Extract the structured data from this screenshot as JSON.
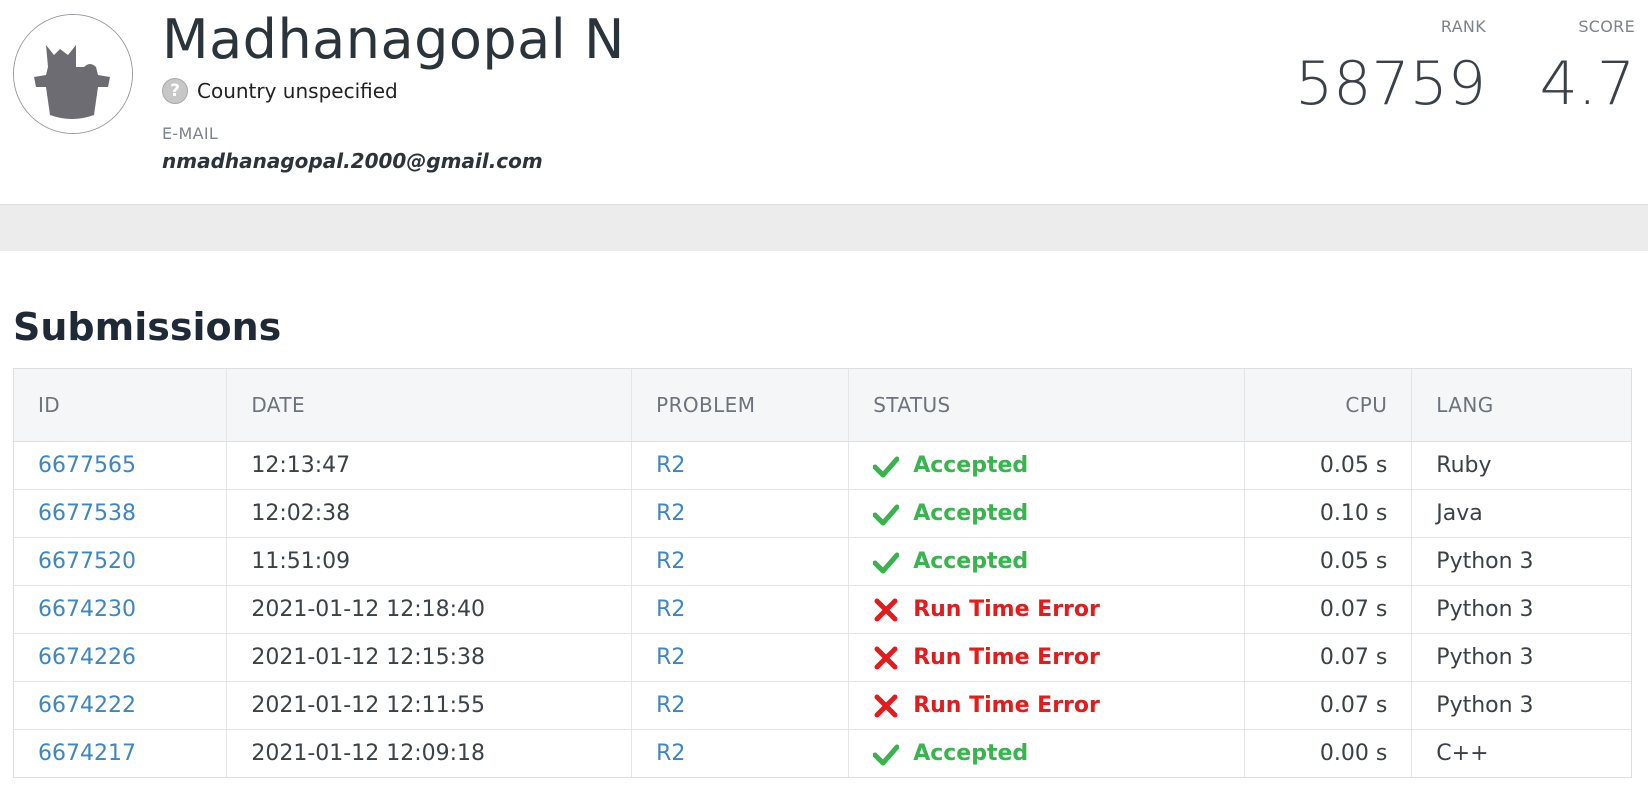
{
  "profile": {
    "name": "Madhanagopal N",
    "country": "Country unspecified",
    "email_label": "E-MAIL",
    "email": "nmadhanagopal.2000@gmail.com",
    "avatar": "cat-avatar-icon",
    "country_icon": "question-mark-icon"
  },
  "stats": {
    "rank_label": "RANK",
    "rank_value": "58759",
    "score_label": "SCORE",
    "score_value": "4.7"
  },
  "submissions": {
    "title": "Submissions",
    "columns": {
      "id": "ID",
      "date": "DATE",
      "problem": "PROBLEM",
      "status": "STATUS",
      "cpu": "CPU",
      "lang": "LANG"
    },
    "rows": [
      {
        "id": "6677565",
        "date": "12:13:47",
        "problem": "R2",
        "status": "Accepted",
        "status_kind": "ok",
        "cpu": "0.05 s",
        "lang": "Ruby"
      },
      {
        "id": "6677538",
        "date": "12:02:38",
        "problem": "R2",
        "status": "Accepted",
        "status_kind": "ok",
        "cpu": "0.10 s",
        "lang": "Java"
      },
      {
        "id": "6677520",
        "date": "11:51:09",
        "problem": "R2",
        "status": "Accepted",
        "status_kind": "ok",
        "cpu": "0.05 s",
        "lang": "Python 3"
      },
      {
        "id": "6674230",
        "date": "2021-01-12 12:18:40",
        "problem": "R2",
        "status": "Run Time Error",
        "status_kind": "err",
        "cpu": "0.07 s",
        "lang": "Python 3"
      },
      {
        "id": "6674226",
        "date": "2021-01-12 12:15:38",
        "problem": "R2",
        "status": "Run Time Error",
        "status_kind": "err",
        "cpu": "0.07 s",
        "lang": "Python 3"
      },
      {
        "id": "6674222",
        "date": "2021-01-12 12:11:55",
        "problem": "R2",
        "status": "Run Time Error",
        "status_kind": "err",
        "cpu": "0.07 s",
        "lang": "Python 3"
      },
      {
        "id": "6674217",
        "date": "2021-01-12 12:09:18",
        "problem": "R2",
        "status": "Accepted",
        "status_kind": "ok",
        "cpu": "0.00 s",
        "lang": "C++"
      }
    ]
  },
  "colors": {
    "accepted": "#35b54a",
    "error": "#e51b1b",
    "link": "#3d85c6"
  }
}
